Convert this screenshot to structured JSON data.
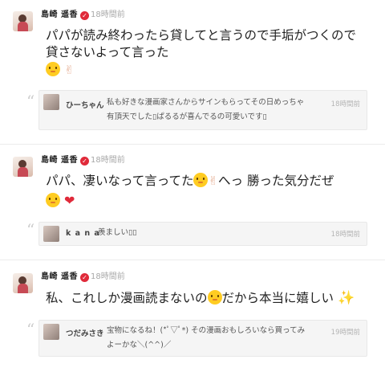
{
  "posts": [
    {
      "author": "島崎 遥香",
      "verified_mark": "✓",
      "time": "18時間前",
      "text_line1": "パパが読み終わったら貸してと言うので手垢がつくので",
      "text_line2": "貸さないよって言った",
      "comment": {
        "name": "ひーちゃん",
        "text_line1": "私も好きな漫画家さんからサインもらってその日めっちゃ",
        "text_line2": "有頂天でした▯ぱるるが喜んでるの可愛いです▯",
        "time": "18時間前"
      }
    },
    {
      "author": "島崎 遥香",
      "verified_mark": "✓",
      "time": "18時間前",
      "text_a": "パパ、凄いなって言ってた",
      "text_b": "へっ 勝った気分だぜ",
      "comment": {
        "name": "k a n a",
        "text_line1": "羨ましい▯▯",
        "time": "18時間前"
      }
    },
    {
      "author": "島崎 遥香",
      "verified_mark": "✓",
      "time": "18時間前",
      "text_a": "私、これしか漫画読まないの",
      "text_b": "だから本当に嬉しい",
      "comment": {
        "name": "つだみさき",
        "text_line1": "宝物になるね！(*ﾟ▽ﾟ*) その漫画おもしろいなら買ってみ",
        "text_line2": "よーかな＼(^^)／",
        "time": "19時間前"
      }
    }
  ],
  "quote_glyph": "“",
  "icons": {
    "hand": "✌",
    "heart": "❤",
    "sparkle": "✨"
  },
  "colors": {
    "verified": "#e02a3a",
    "comment_bg": "#f5f5f5"
  }
}
